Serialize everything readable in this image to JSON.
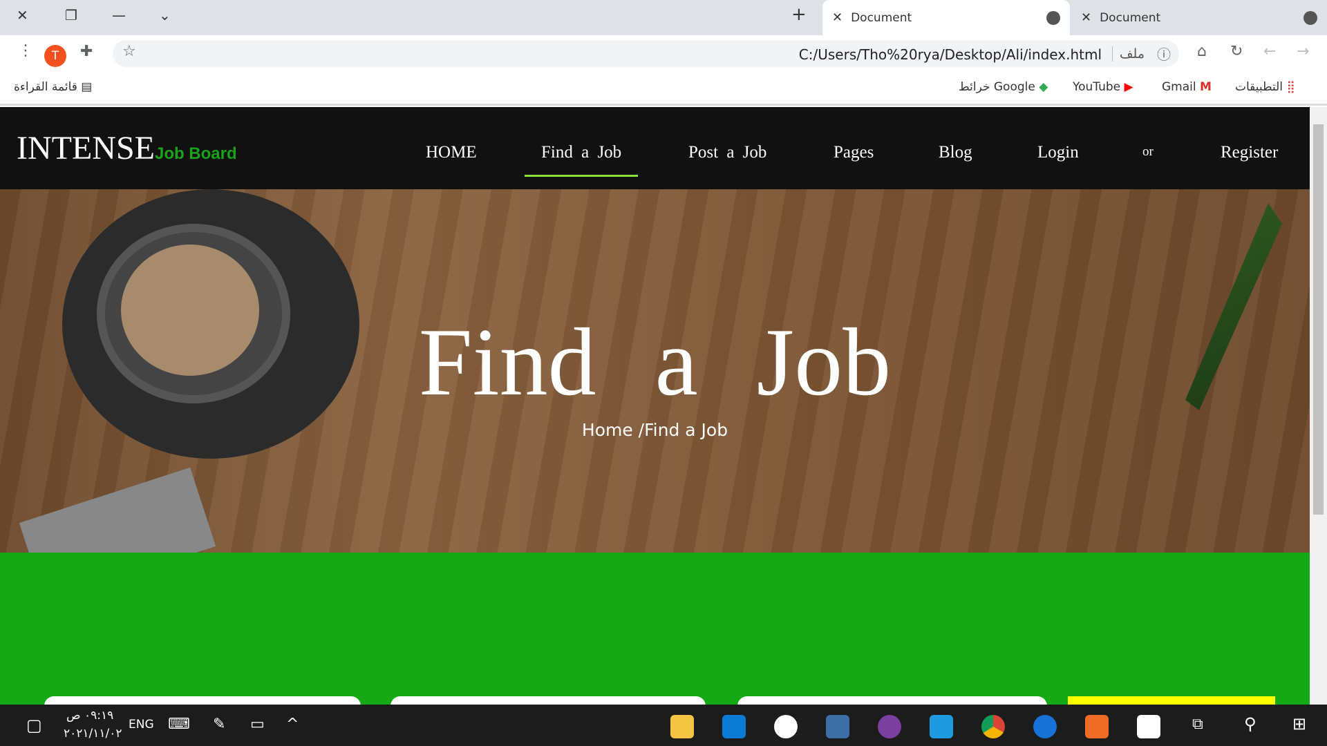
{
  "browser": {
    "tabs": [
      {
        "title": "Document",
        "active": true
      },
      {
        "title": "Document",
        "active": false
      }
    ],
    "url": "C:/Users/Tho%20rya/Desktop/Ali/index.html",
    "scheme_label": "ملف",
    "profile_initial": "T",
    "bookmarks": [
      "التطبيقات",
      "Gmail",
      "YouTube",
      "خرائط Google"
    ],
    "reading_list": "قائمة القراءة"
  },
  "site": {
    "logo_main": "INTENSE",
    "logo_sub": "Job Board",
    "nav": [
      "HOME",
      "Find a Job",
      "Post a Job",
      "Pages",
      "Blog",
      "Login",
      "or",
      "Register"
    ],
    "active_nav": "Find a Job",
    "hero_title": "Find a Job",
    "breadcrumb": "Home /Find a Job"
  },
  "colors": {
    "accent": "#16a916",
    "nav_bg": "#111111",
    "underline": "#8de03a",
    "highlight": "#ffff00"
  },
  "taskbar": {
    "time": "٠٩:١٩ ص",
    "date": "٢٠٢١/١١/٠٢",
    "lang": "ENG"
  }
}
